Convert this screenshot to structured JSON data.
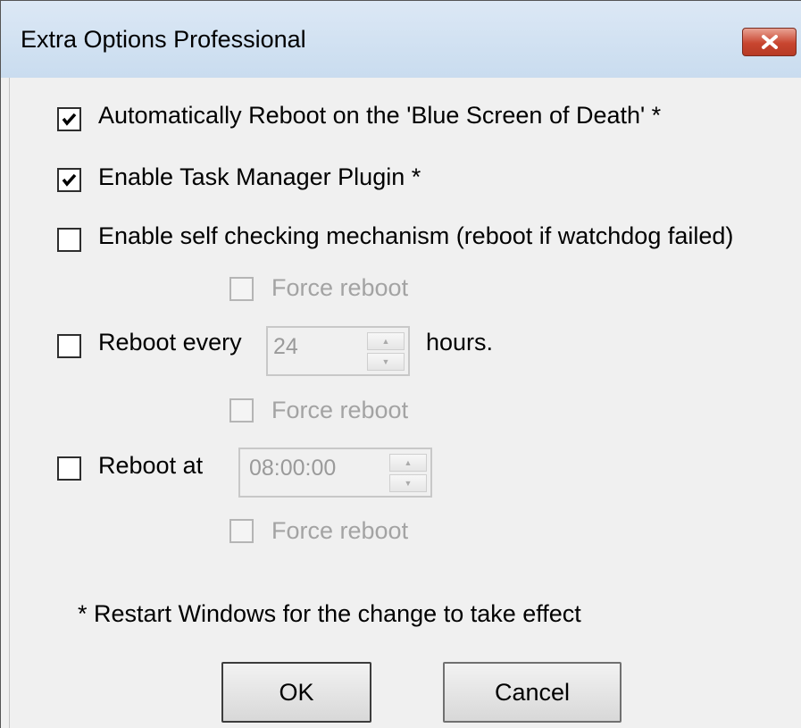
{
  "window": {
    "title": "Extra Options Professional"
  },
  "options": {
    "auto_reboot_bsod": {
      "label": "Automatically Reboot on the 'Blue Screen of Death'  *",
      "checked": true
    },
    "task_manager_plugin": {
      "label": "Enable Task Manager Plugin *",
      "checked": true
    },
    "self_checking": {
      "label": "Enable self checking mechanism (reboot if watchdog failed)",
      "checked": false
    },
    "self_checking_force": {
      "label": "Force reboot",
      "checked": false,
      "enabled": false
    },
    "reboot_every": {
      "label": "Reboot every",
      "value": "24",
      "unit": "hours.",
      "checked": false
    },
    "reboot_every_force": {
      "label": "Force reboot",
      "checked": false,
      "enabled": false
    },
    "reboot_at": {
      "label": "Reboot at",
      "value": "08:00:00",
      "checked": false
    },
    "reboot_at_force": {
      "label": "Force reboot",
      "checked": false,
      "enabled": false
    }
  },
  "footnote": "* Restart Windows for the change to take effect",
  "buttons": {
    "ok": "OK",
    "cancel": "Cancel"
  }
}
